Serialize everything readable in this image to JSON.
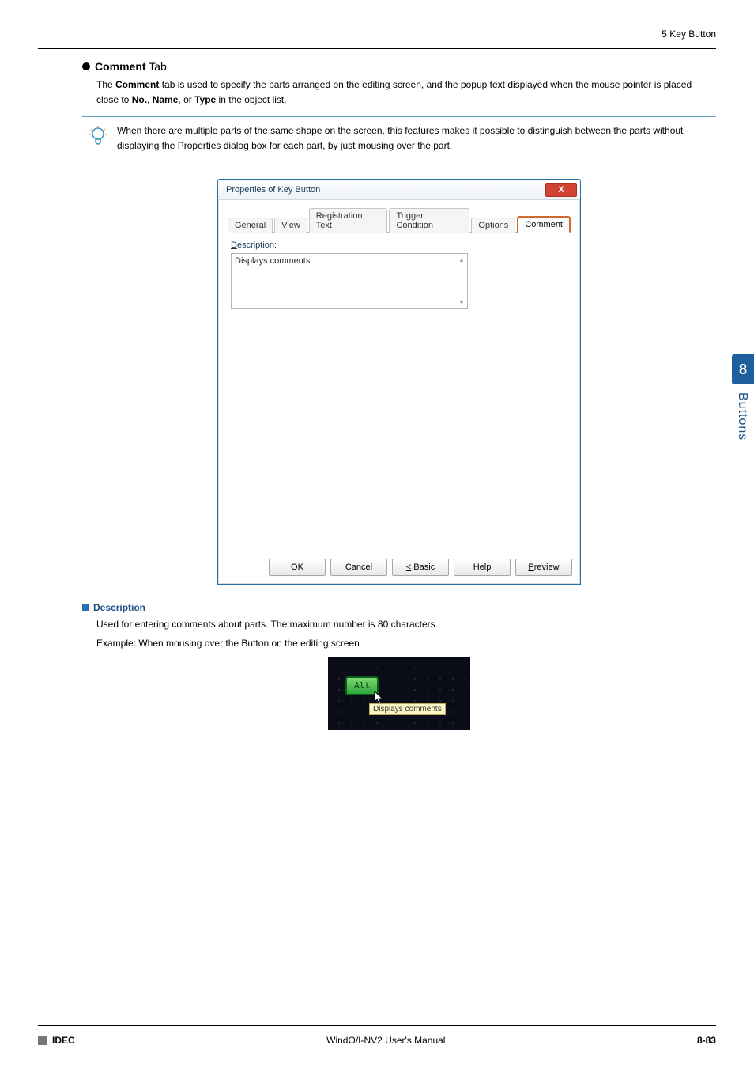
{
  "header": {
    "section": "5 Key Button"
  },
  "heading": {
    "bold": "Comment",
    "rest": " Tab"
  },
  "intro": {
    "pre": "The ",
    "b1": "Comment",
    "mid1": " tab is used to specify the parts arranged on the editing screen, and the popup text displayed when the mouse pointer is placed close to ",
    "b2": "No.",
    "c1": ", ",
    "b3": "Name",
    "c2": ", or ",
    "b4": "Type",
    "post": " in the object list."
  },
  "tip": {
    "text": "When there are multiple parts of the same shape on the screen, this features makes it possible to distinguish between the parts without displaying the Properties dialog box for each part, by just mousing over the part."
  },
  "dialog": {
    "title": "Properties of Key Button",
    "close": "X",
    "tabs": {
      "t1": "General",
      "t2": "View",
      "t3": "Registration Text",
      "t4": "Trigger Condition",
      "t5": "Options",
      "t6": "Comment"
    },
    "desc_label": "Description:",
    "desc_value": "Displays comments",
    "buttons": {
      "ok": "OK",
      "cancel": "Cancel",
      "basic": "< Basic",
      "help": "Help",
      "preview": "Preview"
    }
  },
  "description": {
    "heading": "Description",
    "line1": "Used for entering comments about parts. The maximum number is 80 characters.",
    "line2": "Example: When mousing over the Button on the editing screen"
  },
  "example": {
    "alt": "Alt",
    "tooltip": "Displays comments"
  },
  "side": {
    "num": "8",
    "label": "Buttons"
  },
  "footer": {
    "brand": "IDEC",
    "center": "WindO/I-NV2 User's Manual",
    "page": "8-83"
  }
}
